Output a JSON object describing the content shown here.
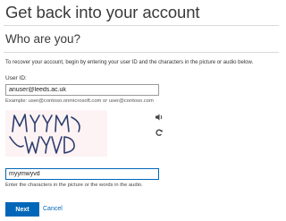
{
  "page": {
    "title": "Get back into your account",
    "subtitle": "Who are you?",
    "instructions": "To recover your account, begin by entering your user ID and the characters in the picture or audio below."
  },
  "user_id": {
    "label": "User ID:",
    "value": "anuser@leeds.ac.uk",
    "example": "Example: user@contoso.onmicrosoft.com or user@contoso.com"
  },
  "captcha": {
    "image_text": "MYYM WYVD",
    "audio_icon": "speaker-icon",
    "refresh_icon": "refresh-icon",
    "value": "myymwyvd",
    "help": "Enter the characters in the picture or the words in the audio."
  },
  "actions": {
    "next_label": "Next",
    "cancel_label": "Cancel"
  },
  "colors": {
    "accent": "#0067b8",
    "captcha_ink": "#2c3e6e",
    "captcha_bg": "#fdf3f4"
  }
}
